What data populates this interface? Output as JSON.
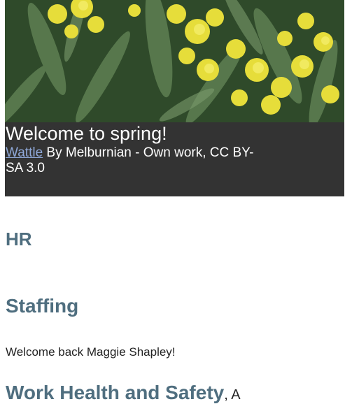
{
  "hero": {
    "image_alt": "Wattle flowers",
    "title": "Welcome to spring!",
    "credit_link": "Wattle",
    "credit_text": " By Melburnian - Own work, CC BY-SA 3.0"
  },
  "sections": {
    "hr_heading": "HR",
    "staffing_heading": "Staffing",
    "staffing_body": "Welcome back Maggie Shapley!",
    "whs_heading": "Work Health and Safety",
    "whs_tail": ", A"
  },
  "colors": {
    "heading": "#4f6e7f",
    "caption_bg": "#333333",
    "link": "#8fa8d8"
  }
}
